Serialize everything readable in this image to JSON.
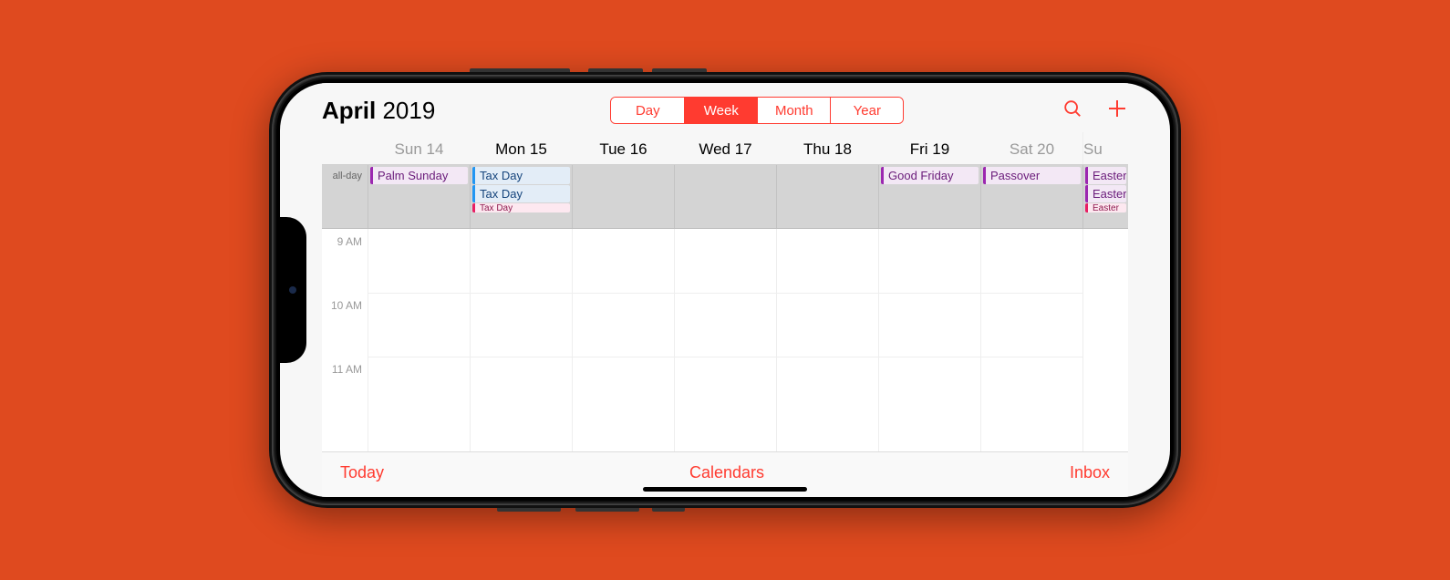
{
  "title": {
    "month": "April",
    "year": "2019"
  },
  "segments": [
    {
      "label": "Day",
      "active": false
    },
    {
      "label": "Week",
      "active": true
    },
    {
      "label": "Month",
      "active": false
    },
    {
      "label": "Year",
      "active": false
    }
  ],
  "days": [
    {
      "label": "Sun 14",
      "dim": true
    },
    {
      "label": "Mon 15",
      "dim": false
    },
    {
      "label": "Tue 16",
      "dim": false
    },
    {
      "label": "Wed 17",
      "dim": false
    },
    {
      "label": "Thu 18",
      "dim": false
    },
    {
      "label": "Fri 19",
      "dim": false
    },
    {
      "label": "Sat 20",
      "dim": true
    }
  ],
  "extra_day_label": "Su",
  "allday_label": "all-day",
  "allday": {
    "0": [
      {
        "title": "Palm Sunday",
        "cls": "purple"
      }
    ],
    "1": [
      {
        "title": "Tax Day",
        "cls": "blue"
      },
      {
        "title": "Tax Day",
        "cls": "blue"
      },
      {
        "title": "Tax Day",
        "cls": "pink",
        "cut": true
      }
    ],
    "2": [],
    "3": [],
    "4": [],
    "5": [
      {
        "title": "Good Friday",
        "cls": "purple"
      }
    ],
    "6": [
      {
        "title": "Passover",
        "cls": "purple"
      }
    ],
    "extra": [
      {
        "title": "Easter",
        "cls": "purple"
      },
      {
        "title": "Easter",
        "cls": "purple"
      },
      {
        "title": "Easter",
        "cls": "pink",
        "cut": true
      }
    ]
  },
  "hours": [
    "9 AM",
    "10 AM",
    "11 AM"
  ],
  "toolbar": {
    "today": "Today",
    "calendars": "Calendars",
    "inbox": "Inbox"
  }
}
